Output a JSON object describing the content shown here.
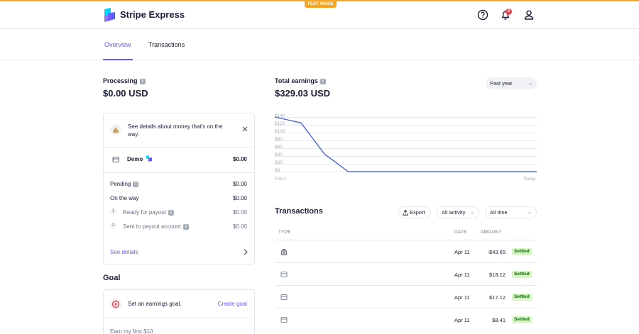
{
  "app": {
    "name": "Stripe Express",
    "test_mode_label": "TEST MODE",
    "notification_count": "2"
  },
  "tabs": [
    {
      "label": "Overview",
      "active": true
    },
    {
      "label": "Transactions",
      "active": false
    }
  ],
  "processing": {
    "label": "Processing",
    "amount": "$0.00 USD",
    "notice": "See details about money that's on the way.",
    "account_name": "Demo",
    "account_amount": "$0.00",
    "pending_label": "Pending",
    "pending_amount": "$0.00",
    "on_the_way_label": "On the way",
    "on_the_way_amount": "$0.00",
    "steps": [
      {
        "num": "1",
        "label": "Ready for payout",
        "amount": "$0.00"
      },
      {
        "num": "2",
        "label": "Sent to payout account",
        "amount": "$0.00"
      }
    ],
    "see_details": "See details"
  },
  "goal": {
    "title": "Goal",
    "prompt": "Set an earnings goal.",
    "create_label": "Create goal",
    "partial_text": "Earn my first $10"
  },
  "earnings": {
    "label": "Total earnings",
    "amount": "$329.03 USD",
    "period": "Past year"
  },
  "chart_data": {
    "type": "line",
    "x_start_label": "Feb 1",
    "x_end_label": "Today",
    "y_ticks": [
      "$140",
      "$120",
      "$100",
      "$80",
      "$60",
      "$40",
      "$20",
      "$0"
    ],
    "ylim": [
      0,
      140
    ],
    "x": [
      0,
      0.1,
      0.19,
      0.28,
      1.0
    ],
    "values": [
      140,
      125,
      45,
      0,
      0
    ],
    "line_color": "#3f5bd9"
  },
  "transactions": {
    "title": "Transactions",
    "export_label": "Export",
    "activity_filter": "All activity",
    "time_filter": "All time",
    "columns": {
      "type": "TYPE",
      "date": "DATE",
      "amount": "AMOUNT"
    },
    "rows": [
      {
        "icon": "bank-icon",
        "date": "Apr 11",
        "amount": "-$43.65",
        "status": "Settled"
      },
      {
        "icon": "payment-icon",
        "date": "Apr 11",
        "amount": "$18.12",
        "status": "Settled"
      },
      {
        "icon": "payment-icon",
        "date": "Apr 11",
        "amount": "$17.12",
        "status": "Settled"
      },
      {
        "icon": "payment-icon",
        "date": "Apr 11",
        "amount": "$8.41",
        "status": "Settled"
      }
    ]
  }
}
